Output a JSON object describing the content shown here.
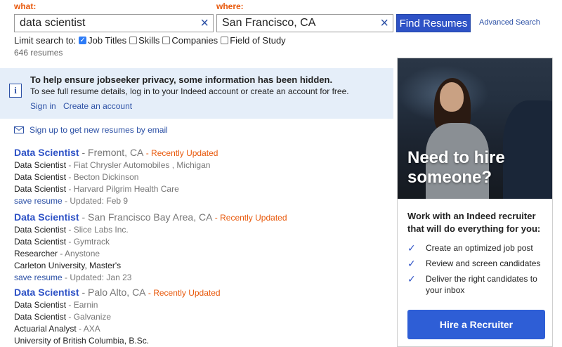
{
  "search": {
    "what_label": "what:",
    "what_value": "data scientist",
    "where_label": "where:",
    "where_value": "San Francisco, CA",
    "clear_glyph": "×",
    "find_button": "Find Resumes",
    "advanced_link": "Advanced Search",
    "limit_label": "Limit search to:",
    "filters": [
      {
        "label": "Job Titles",
        "checked": true
      },
      {
        "label": "Skills",
        "checked": false
      },
      {
        "label": "Companies",
        "checked": false
      },
      {
        "label": "Field of Study",
        "checked": false
      }
    ],
    "result_count": "646 resumes"
  },
  "privacy": {
    "icon": "info-icon",
    "heading": "To help ensure jobseeker privacy, some information has been hidden.",
    "body": "To see full resume details, log in to your Indeed account or create an account for free.",
    "sign_in": "Sign in",
    "create_account": "Create an account"
  },
  "email_alert": {
    "icon": "envelope-icon",
    "text": "Sign up to get new resumes by email"
  },
  "results": [
    {
      "title": "Data Scientist",
      "location": " - Fremont, CA",
      "updated_flag": " - Recently Updated",
      "lines": [
        {
          "role": "Data Scientist",
          "org": " - Fiat Chrysler Automobiles , Michigan"
        },
        {
          "role": "Data Scientist",
          "org": " - Becton Dickinson"
        },
        {
          "role": "Data Scientist",
          "org": " - Harvard Pilgrim Health Care"
        }
      ],
      "save": "save resume",
      "updated": " - Updated: Feb 9"
    },
    {
      "title": "Data Scientist",
      "location": " - San Francisco Bay Area, CA",
      "updated_flag": " - Recently Updated",
      "lines": [
        {
          "role": "Data Scientist",
          "org": " - Slice Labs Inc."
        },
        {
          "role": "Data Scientist",
          "org": " - Gymtrack"
        },
        {
          "role": "Researcher",
          "org": " - Anystone"
        },
        {
          "role": "Carleton University, Master's",
          "org": ""
        }
      ],
      "save": "save resume",
      "updated": " - Updated: Jan 23"
    },
    {
      "title": "Data Scientist",
      "location": " - Palo Alto, CA",
      "updated_flag": " - Recently Updated",
      "lines": [
        {
          "role": "Data Scientist",
          "org": " - Earnin"
        },
        {
          "role": "Data Scientist",
          "org": " - Galvanize"
        },
        {
          "role": "Actuarial Analyst",
          "org": " - AXA"
        },
        {
          "role": "University of British Columbia, B.Sc.",
          "org": ""
        }
      ]
    }
  ],
  "ad": {
    "headline_1": "Need to hire",
    "headline_2": "someone?",
    "subhead": "Work with an Indeed recruiter that will do everything for you:",
    "items": [
      "Create an optimized job post",
      "Review and screen candidates",
      "Deliver the right candidates to your inbox"
    ],
    "check_icon": "checkmark-icon",
    "button": "Hire a Recruiter"
  },
  "colors": {
    "accent_orange": "#e8590c",
    "link_blue": "#2e52a6",
    "button_blue": "#2e52c6",
    "privacy_bg": "#e5eef9"
  }
}
